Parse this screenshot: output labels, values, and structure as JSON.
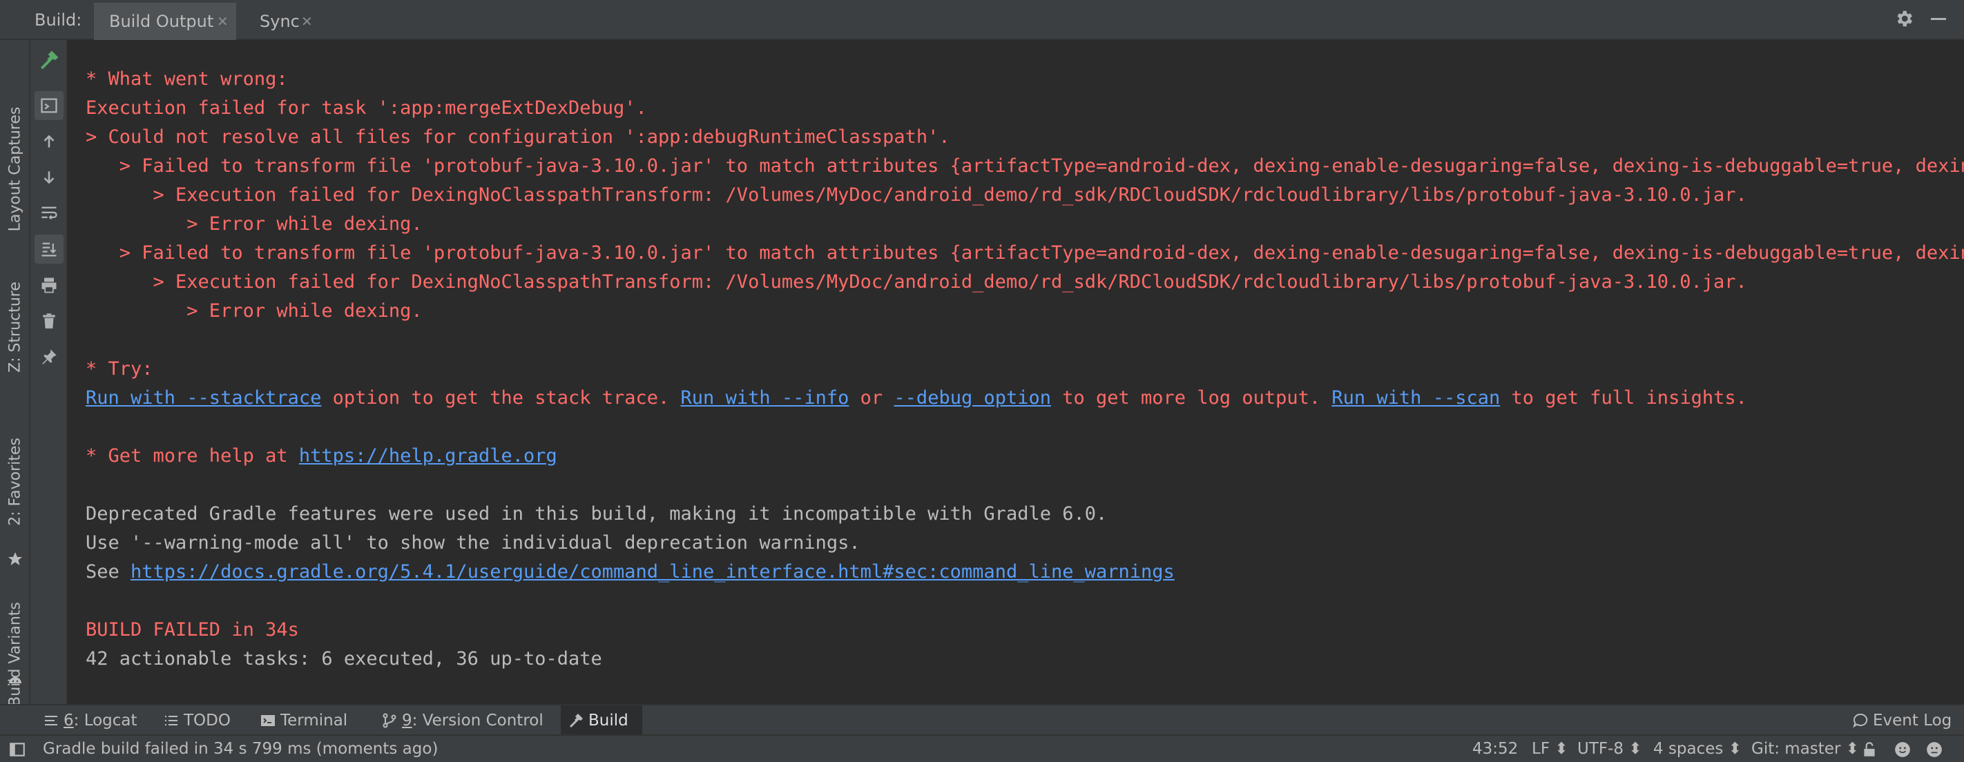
{
  "header": {
    "build_label": "Build:",
    "tabs": [
      {
        "label": "Build Output",
        "active": true
      },
      {
        "label": "Sync",
        "active": false
      }
    ]
  },
  "left_tool_windows": [
    "Layout Captures",
    "Z: Structure",
    "2: Favorites",
    "Build Variants"
  ],
  "console": {
    "lines": [
      {
        "text": "* What went wrong:",
        "color": "red"
      },
      {
        "text": "Execution failed for task ':app:mergeExtDexDebug'.",
        "color": "red"
      },
      {
        "text": "> Could not resolve all files for configuration ':app:debugRuntimeClasspath'.",
        "color": "red"
      },
      {
        "text": "   > Failed to transform file 'protobuf-java-3.10.0.jar' to match attributes {artifactType=android-dex, dexing-enable-desugaring=false, dexing-is-debuggable=true, dexing-",
        "color": "red"
      },
      {
        "text": "      > Execution failed for DexingNoClasspathTransform: /Volumes/MyDoc/android_demo/rd_sdk/RDCloudSDK/rdcloudlibrary/libs/protobuf-java-3.10.0.jar.",
        "color": "red"
      },
      {
        "text": "         > Error while dexing.",
        "color": "red"
      },
      {
        "text": "   > Failed to transform file 'protobuf-java-3.10.0.jar' to match attributes {artifactType=android-dex, dexing-enable-desugaring=false, dexing-is-debuggable=true, dexing-",
        "color": "red"
      },
      {
        "text": "      > Execution failed for DexingNoClasspathTransform: /Volumes/MyDoc/android_demo/rd_sdk/RDCloudSDK/rdcloudlibrary/libs/protobuf-java-3.10.0.jar.",
        "color": "red"
      },
      {
        "text": "         > Error while dexing.",
        "color": "red"
      }
    ],
    "try": {
      "heading": "* Try:",
      "link_stacktrace": "Run with --stacktrace",
      "text_1": " option to get the stack trace. ",
      "link_info": "Run with --info",
      "text_2": " or ",
      "link_debug": "--debug option",
      "text_3": " to get more log output. ",
      "link_scan": "Run with --scan",
      "text_4": " to get full insights."
    },
    "help": {
      "prefix": "* Get more help at ",
      "link": "https://help.gradle.org"
    },
    "deprecation": {
      "line1": "Deprecated Gradle features were used in this build, making it incompatible with Gradle 6.0.",
      "line2": "Use '--warning-mode all' to show the individual deprecation warnings.",
      "line3_prefix": "See ",
      "line3_link": "https://docs.gradle.org/5.4.1/userguide/command_line_interface.html#sec:command_line_warnings"
    },
    "result": {
      "status": "BUILD FAILED in 34s",
      "tasks": "42 actionable tasks: 6 executed, 36 up-to-date"
    }
  },
  "bottom_tabs": [
    {
      "mnemonic": "6",
      "label": ": Logcat"
    },
    {
      "mnemonic": "",
      "label": "TODO"
    },
    {
      "mnemonic": "",
      "label": "Terminal"
    },
    {
      "mnemonic": "9",
      "label": ": Version Control"
    },
    {
      "mnemonic": "",
      "label": "Build",
      "active": true
    }
  ],
  "event_log": "Event Log",
  "status_bar": {
    "message": "Gradle build failed in 34 s 799 ms (moments ago)",
    "position": "43:52",
    "line_separator": "LF",
    "encoding": "UTF-8",
    "indent": "4 spaces",
    "vcs_branch": "Git: master"
  },
  "colors": {
    "error": "#ff6b68",
    "link": "#589df6",
    "text": "#bbbbbb",
    "background": "#2b2b2b",
    "panel": "#3c3f41"
  }
}
